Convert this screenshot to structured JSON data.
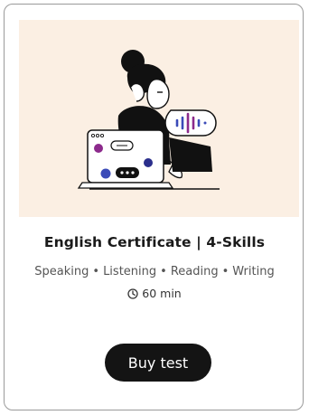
{
  "card": {
    "title": "English Certificate | 4-Skills",
    "skills": [
      "Speaking",
      "Listening",
      "Reading",
      "Writing"
    ],
    "skill_separator": "•",
    "duration": "60 min",
    "buy_label": "Buy test"
  },
  "icons": {
    "illustration": "woman-listening-laptop-illustration",
    "duration": "clock-icon"
  },
  "colors": {
    "illustration_bg": "#fbefe3",
    "button_bg": "#141414",
    "button_text": "#ffffff",
    "accent_purple": "#8c2a8c",
    "accent_blue": "#3b4bb8"
  }
}
